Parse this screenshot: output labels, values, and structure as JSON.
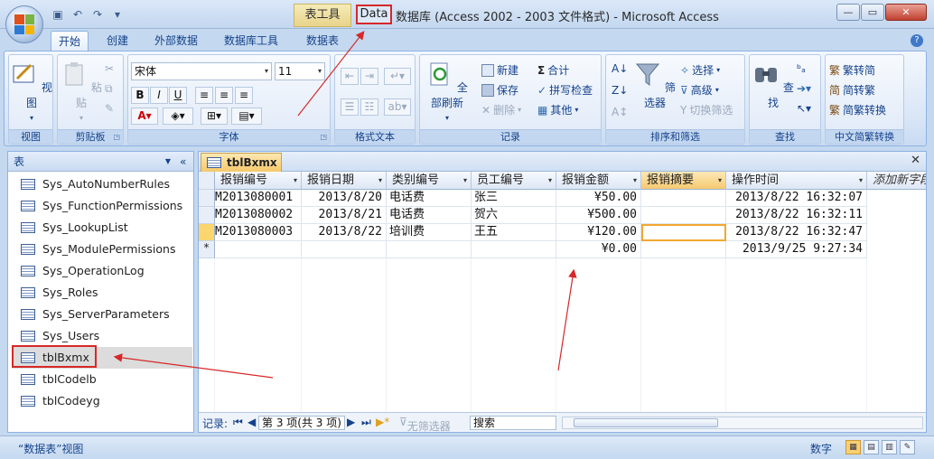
{
  "titlebar": {
    "context_tab": "表工具",
    "highlighted_db": "Data",
    "title": "数据库 (Access 2002 - 2003 文件格式) - Microsoft Access",
    "min": "—",
    "max": "▭",
    "close": "✕"
  },
  "ribbon_tabs": [
    "开始",
    "创建",
    "外部数据",
    "数据库工具",
    "数据表"
  ],
  "help": "?",
  "ribbon": {
    "view": {
      "label": "视图",
      "group": "视图"
    },
    "clipboard": {
      "paste": "粘贴",
      "group": "剪贴板"
    },
    "font": {
      "name": "宋体",
      "size": "11",
      "bold": "B",
      "italic": "I",
      "underline": "U",
      "group": "字体"
    },
    "rich": {
      "group": "格式文本"
    },
    "records": {
      "refresh": "全部刷新",
      "new": "新建",
      "save": "保存",
      "delete": "删除",
      "totals": "合计",
      "spelling": "拼写检查",
      "more": "其他",
      "group": "记录"
    },
    "sort": {
      "filter": "筛选器",
      "selection": "选择",
      "advanced": "高级",
      "toggle": "切换筛选",
      "group": "排序和筛选"
    },
    "find": {
      "find": "查找",
      "group": "查找"
    },
    "chinese": {
      "t2s": "繁转简",
      "s2t": "简转繁",
      "convert": "简繁转换",
      "group": "中文简繁转换"
    }
  },
  "nav": {
    "header": "表",
    "items": [
      "Sys_AutoNumberRules",
      "Sys_FunctionPermissions",
      "Sys_LookupList",
      "Sys_ModulePermissions",
      "Sys_OperationLog",
      "Sys_Roles",
      "Sys_ServerParameters",
      "Sys_Users",
      "tblBxmx",
      "tblCodelb",
      "tblCodeyg"
    ]
  },
  "datasheet": {
    "tab": "tblBxmx",
    "columns": [
      "报销编号",
      "报销日期",
      "类别编号",
      "员工编号",
      "报销金额",
      "报销摘要",
      "操作时间",
      "添加新字段"
    ],
    "rows": [
      [
        "M2013080001",
        "2013/8/20",
        "电话费",
        "张三",
        "¥50.00",
        "",
        "2013/8/22 16:32:07"
      ],
      [
        "M2013080002",
        "2013/8/21",
        "电话费",
        "贺六",
        "¥500.00",
        "",
        "2013/8/22 16:32:11"
      ],
      [
        "M2013080003",
        "2013/8/22",
        "培训费",
        "王五",
        "¥120.00",
        "",
        "2013/8/22 16:32:47"
      ]
    ],
    "new_row": {
      "marker": "*",
      "amount": "¥0.00",
      "time": "2013/9/25 9:27:34"
    },
    "recnav": {
      "label": "记录:",
      "position": "第 3 项(共 3 项)",
      "nofilter": "无筛选器",
      "search": "搜索"
    }
  },
  "status": {
    "left": "“数据表”视图",
    "mode": "数字"
  }
}
